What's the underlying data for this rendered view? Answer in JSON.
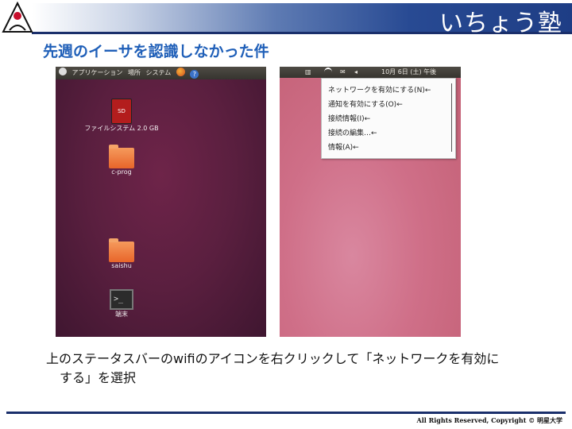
{
  "header": {
    "brand": "いちょう塾",
    "title": "先週のイーサを認識しなかった件"
  },
  "colors": {
    "title": "#1f5fb8",
    "rule": "#1a2f6b",
    "desktop_left": "#5a1f3f",
    "desktop_right": "#cf6f88"
  },
  "left_screen": {
    "menu": [
      "アプリケーション",
      "場所",
      "システム"
    ],
    "icons": [
      {
        "label": "ファイルシステム 2.0 GB",
        "icon": "sd-card-icon",
        "badge": "SD"
      },
      {
        "label": "c-prog",
        "icon": "folder-icon"
      },
      {
        "label": "saishu",
        "icon": "folder-icon"
      },
      {
        "label": "端末",
        "icon": "terminal-icon",
        "glyph": ">_"
      }
    ]
  },
  "right_screen": {
    "panel_date": "10月 6日 (土) 午後",
    "menu_items": [
      "ネットワークを有効にする(N)←",
      "通知を有効にする(O)←",
      "接続情報(I)←",
      "接続の編集…←",
      "情報(A)←"
    ]
  },
  "caption": {
    "line1": "上のステータスバーのwifiのアイコンを右クリックして「ネットワークを有効に",
    "line2": "する」を選択"
  },
  "footer": {
    "copyright": "All Rights Reserved, Copyright © 明星大学"
  }
}
